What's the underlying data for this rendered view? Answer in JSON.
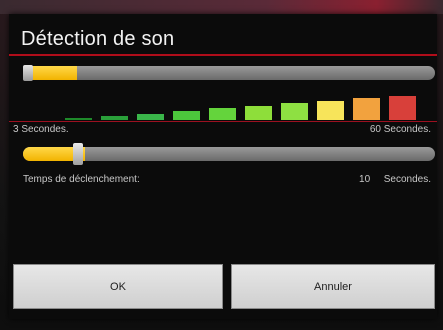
{
  "dialog": {
    "title": "Détection de son"
  },
  "sound_level": {
    "fill_fraction": 0.13,
    "meter_colors": [
      "#1e8a2a",
      "#2aa03a",
      "#3ab64a",
      "#4cc63c",
      "#64d43c",
      "#8ede3a",
      "#8ee042",
      "#f7e45a",
      "#f2a23e",
      "#d8403a"
    ],
    "meter_heights": [
      0.06,
      0.12,
      0.2,
      0.28,
      0.36,
      0.44,
      0.52,
      0.6,
      0.68,
      0.76
    ]
  },
  "range": {
    "min_label": "3 Secondes.",
    "max_label": "60 Secondes."
  },
  "trigger": {
    "fill_fraction": 0.15,
    "label": "Temps de déclenchement:",
    "value": "10",
    "unit": "Secondes."
  },
  "buttons": {
    "ok": "OK",
    "cancel": "Annuler"
  }
}
